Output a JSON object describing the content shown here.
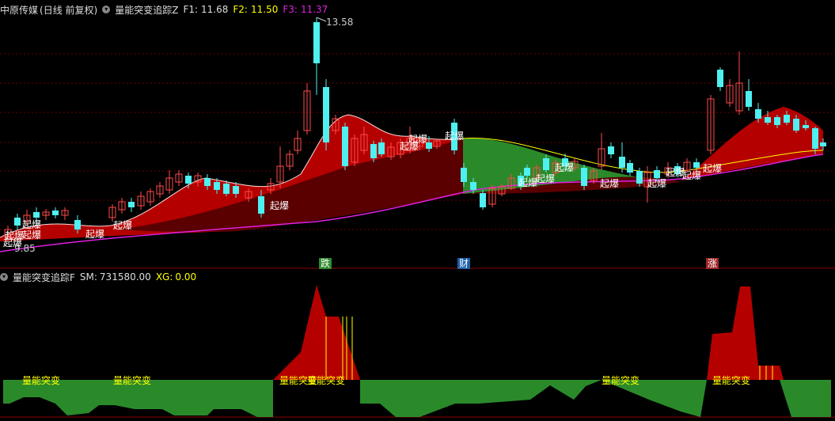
{
  "top": {
    "stock_name": "中原传媒",
    "period": "(日线 前复权)",
    "indicator": "量能突变追踪Z",
    "f1_label": "F1:",
    "f1_value": "11.68",
    "f2_label": "F2:",
    "f2_value": "11.50",
    "f3_label": "F3:",
    "f3_value": "11.37",
    "high_label": "13.58",
    "low_label": "9.85"
  },
  "bottom": {
    "indicator": "量能突变追踪F",
    "sm_label": "SM:",
    "sm_value": "731580.00",
    "xg_label": "XG:",
    "xg_value": "0.00"
  },
  "signal_text": "起爆",
  "volume_text": "量能突变",
  "events": [
    {
      "text": "跌",
      "color": "#2e8b2e"
    },
    {
      "text": "财",
      "color": "#1e5fa8"
    },
    {
      "text": "涨",
      "color": "#a02828"
    }
  ],
  "colors": {
    "up": "#ff4a4a",
    "down": "#4ef0f0",
    "red_area": "#b50000",
    "dark_red": "#5a0000",
    "green_area": "#2a8a2a",
    "magenta": "#e020e0",
    "yellow": "#ffff00",
    "grid": "#6b0000"
  }
}
